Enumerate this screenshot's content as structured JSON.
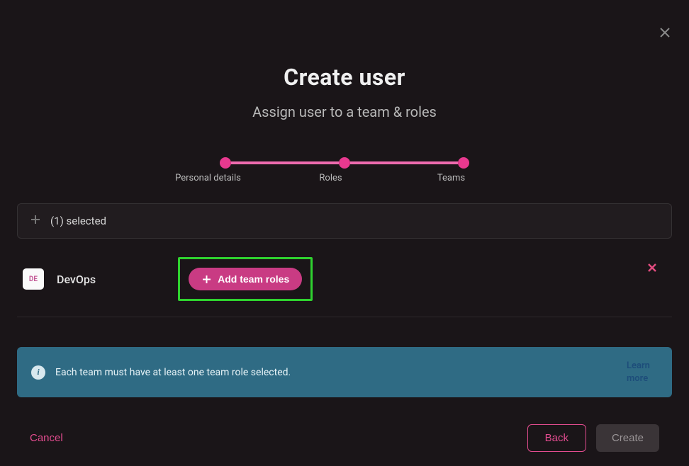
{
  "header": {
    "title": "Create user",
    "subtitle": "Assign user to a team & roles"
  },
  "stepper": {
    "steps": [
      "Personal details",
      "Roles",
      "Teams"
    ]
  },
  "selector": {
    "selected_text": "(1) selected"
  },
  "team": {
    "badge": "DE",
    "name": "DevOps",
    "add_roles_label": "Add team roles"
  },
  "banner": {
    "text": "Each team must have at least one team role selected.",
    "learn_more": "Learn more"
  },
  "footer": {
    "cancel": "Cancel",
    "back": "Back",
    "create": "Create"
  }
}
